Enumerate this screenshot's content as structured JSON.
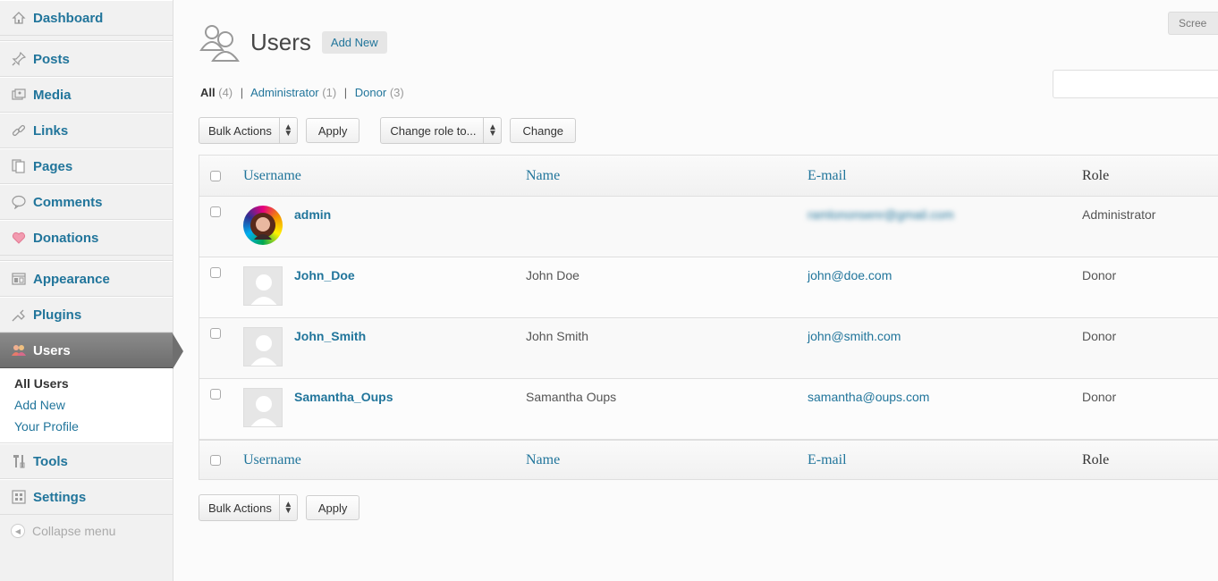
{
  "sidebar": {
    "items": [
      {
        "label": "Dashboard",
        "icon": "dashboard-icon"
      },
      {
        "label": "Posts",
        "icon": "pushpin-icon"
      },
      {
        "label": "Media",
        "icon": "media-icon"
      },
      {
        "label": "Links",
        "icon": "link-icon"
      },
      {
        "label": "Pages",
        "icon": "pages-icon"
      },
      {
        "label": "Comments",
        "icon": "comment-bubble-icon"
      },
      {
        "label": "Donations",
        "icon": "heart-icon"
      },
      {
        "label": "Appearance",
        "icon": "appearance-icon"
      },
      {
        "label": "Plugins",
        "icon": "plug-icon"
      },
      {
        "label": "Users",
        "icon": "users-icon"
      },
      {
        "label": "Tools",
        "icon": "tools-icon"
      },
      {
        "label": "Settings",
        "icon": "settings-icon"
      }
    ],
    "submenu": [
      "All Users",
      "Add New",
      "Your Profile"
    ],
    "collapse_label": "Collapse menu"
  },
  "header": {
    "screen_options": "Scree",
    "title": "Users",
    "add_new": "Add New"
  },
  "filters": {
    "all": "All",
    "all_count": "(4)",
    "administrator": "Administrator",
    "administrator_count": "(1)",
    "donor": "Donor",
    "donor_count": "(3)",
    "separator": "|"
  },
  "tablenav": {
    "bulk_actions": "Bulk Actions",
    "apply": "Apply",
    "change_role": "Change role to...",
    "change": "Change"
  },
  "table": {
    "columns": [
      "Username",
      "Name",
      "E-mail",
      "Role"
    ],
    "rows": [
      {
        "username": "admin",
        "name": "",
        "email": "ramlononsenr@gmail.com",
        "role": "Administrator"
      },
      {
        "username": "John_Doe",
        "name": "John Doe",
        "email": "john@doe.com",
        "role": "Donor"
      },
      {
        "username": "John_Smith",
        "name": "John Smith",
        "email": "john@smith.com",
        "role": "Donor"
      },
      {
        "username": "Samantha_Oups",
        "name": "Samantha Oups",
        "email": "samantha@oups.com",
        "role": "Donor"
      }
    ]
  },
  "colors": {
    "link": "#21759b",
    "current_menu": "#6d6d6d"
  }
}
